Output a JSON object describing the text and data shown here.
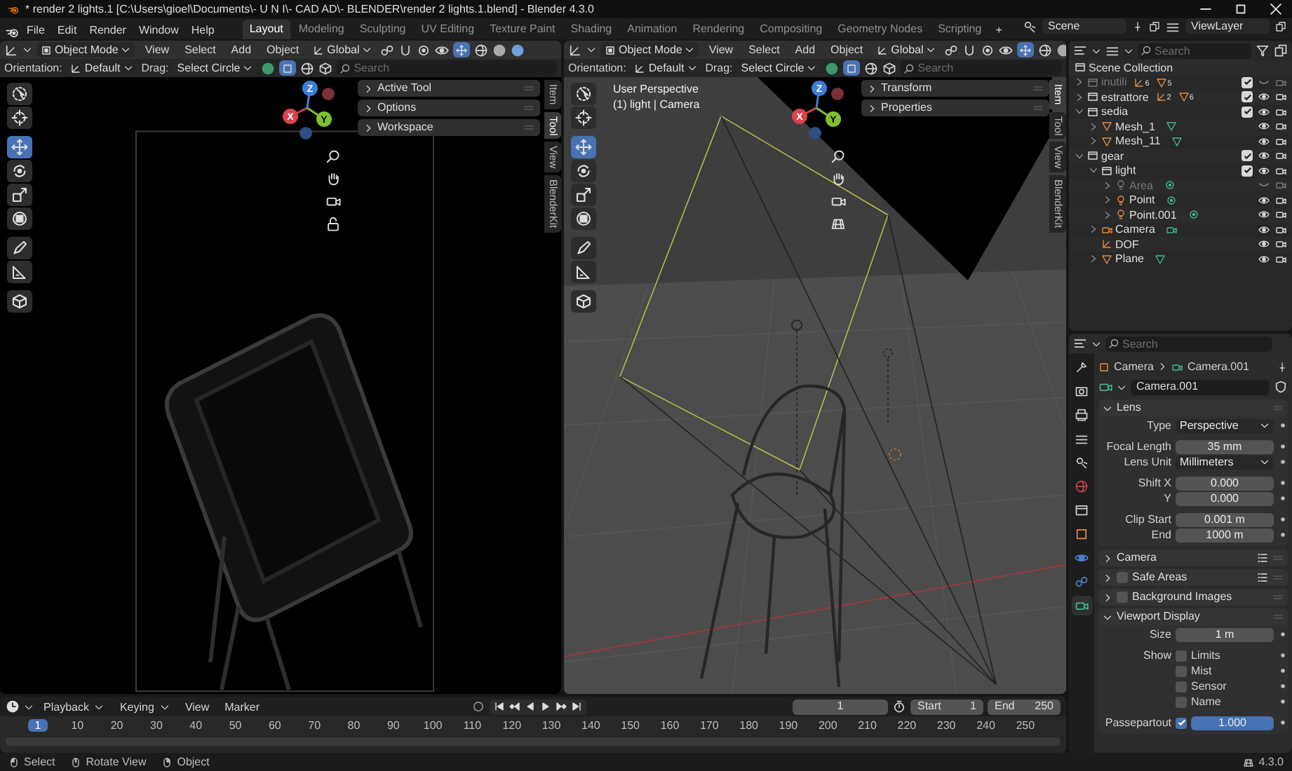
{
  "window": {
    "title": "* render 2 lights.1 [C:\\Users\\gioel\\Documents\\- U N I\\- CAD AD\\- BLENDER\\render 2 lights.1.blend] - Blender 4.3.0"
  },
  "menu": [
    "File",
    "Edit",
    "Render",
    "Window",
    "Help"
  ],
  "workspaces": [
    {
      "label": "Layout",
      "selected": true
    },
    {
      "label": "Modeling",
      "selected": false
    },
    {
      "label": "Sculpting",
      "selected": false
    },
    {
      "label": "UV Editing",
      "selected": false
    },
    {
      "label": "Texture Paint",
      "selected": false
    },
    {
      "label": "Shading",
      "selected": false
    },
    {
      "label": "Animation",
      "selected": false
    },
    {
      "label": "Rendering",
      "selected": false
    },
    {
      "label": "Compositing",
      "selected": false
    },
    {
      "label": "Geometry Nodes",
      "selected": false
    },
    {
      "label": "Scripting",
      "selected": false
    }
  ],
  "add_workspace": "+",
  "scene": "Scene",
  "view_layer": "ViewLayer",
  "viewports": [
    {
      "kind": "camera_render",
      "mode": "Object Mode",
      "menus": [
        "View",
        "Select",
        "Add",
        "Object"
      ],
      "transform": "Global",
      "orientation_label": "Orientation:",
      "orientation": "Default",
      "drag_label": "Drag:",
      "drag": "Select Circle",
      "search_placeholder": "Search",
      "gizmo": [
        "X",
        "Y",
        "Z"
      ],
      "tools": [
        {
          "kind": "select",
          "selected": false
        },
        {
          "kind": "cursor",
          "selected": false
        },
        {
          "kind": "move",
          "selected": true
        },
        {
          "kind": "rotate",
          "selected": false
        },
        {
          "kind": "scale",
          "selected": false
        },
        {
          "kind": "transform",
          "selected": false
        },
        {
          "kind": "annotate",
          "selected": false
        },
        {
          "kind": "measure",
          "selected": false
        },
        {
          "kind": "add_cube",
          "selected": false
        }
      ],
      "panels": [
        {
          "label": "Active Tool",
          "expanded": false
        },
        {
          "label": "Options",
          "expanded": false
        },
        {
          "label": "Workspace",
          "expanded": false
        }
      ],
      "tabs": [
        {
          "label": "Item",
          "selected": false
        },
        {
          "label": "Tool",
          "selected": true
        },
        {
          "label": "View",
          "selected": false
        },
        {
          "label": "BlenderKit",
          "selected": false
        }
      ]
    },
    {
      "kind": "perspective",
      "mode": "Object Mode",
      "menus": [
        "View",
        "Select",
        "Add",
        "Object"
      ],
      "transform": "Global",
      "orientation_label": "Orientation:",
      "orientation": "Default",
      "drag_label": "Drag:",
      "drag": "Select Circle",
      "search_placeholder": "Search",
      "gizmo": [
        "X",
        "Y",
        "Z"
      ],
      "overlay": [
        "User Perspective",
        "(1) light | Camera"
      ],
      "tools": [
        {
          "kind": "select",
          "selected": false
        },
        {
          "kind": "cursor",
          "selected": false
        },
        {
          "kind": "move",
          "selected": true
        },
        {
          "kind": "rotate",
          "selected": false
        },
        {
          "kind": "scale",
          "selected": false
        },
        {
          "kind": "transform",
          "selected": false
        },
        {
          "kind": "annotate",
          "selected": false
        },
        {
          "kind": "measure",
          "selected": false
        },
        {
          "kind": "add_cube",
          "selected": false
        }
      ],
      "panels": [
        {
          "label": "Transform",
          "expanded": false
        },
        {
          "label": "Properties",
          "expanded": false
        }
      ],
      "tabs": [
        {
          "label": "Item",
          "selected": true
        },
        {
          "label": "Tool",
          "selected": false
        },
        {
          "label": "View",
          "selected": false
        },
        {
          "label": "BlenderKit",
          "selected": false
        }
      ]
    }
  ],
  "outliner": {
    "search_placeholder": "Search",
    "root": "Scene Collection",
    "items": [
      {
        "name": "inutili",
        "kind": "collection",
        "expanded": false,
        "checked": true,
        "visible": false,
        "counts": [
          {
            "kind": "empty",
            "count": "6"
          },
          {
            "kind": "mesh",
            "count": "5"
          }
        ]
      },
      {
        "name": "estrattore",
        "kind": "collection",
        "expanded": false,
        "checked": true,
        "visible": true,
        "counts": [
          {
            "kind": "empty",
            "count": "2"
          },
          {
            "kind": "mesh",
            "count": "6"
          }
        ]
      },
      {
        "name": "sedia",
        "kind": "collection",
        "expanded": true,
        "checked": true,
        "visible": true,
        "children": [
          {
            "name": "Mesh_1",
            "kind": "mesh",
            "expanded": false,
            "visible": true
          },
          {
            "name": "Mesh_11",
            "kind": "mesh",
            "expanded": false,
            "visible": true
          }
        ]
      },
      {
        "name": "gear",
        "kind": "collection",
        "expanded": true,
        "checked": true,
        "visible": true,
        "children": [
          {
            "name": "light",
            "kind": "collection",
            "expanded": true,
            "checked": true,
            "visible": true,
            "children": [
              {
                "name": "Area",
                "kind": "light",
                "expanded": false,
                "visible": false
              },
              {
                "name": "Point",
                "kind": "light",
                "expanded": false,
                "visible": true
              },
              {
                "name": "Point.001",
                "kind": "light",
                "expanded": false,
                "visible": true
              }
            ]
          },
          {
            "name": "Camera",
            "kind": "camera",
            "expanded": false,
            "visible": true
          },
          {
            "name": "DOF",
            "kind": "empty",
            "visible": true
          },
          {
            "name": "Plane",
            "kind": "mesh",
            "expanded": false,
            "visible": true
          }
        ]
      }
    ]
  },
  "properties": {
    "search_placeholder": "Search",
    "tabs": [
      {
        "kind": "tool",
        "selected": false
      },
      {
        "kind": "render",
        "selected": false
      },
      {
        "kind": "output",
        "selected": false
      },
      {
        "kind": "view_layer",
        "selected": false
      },
      {
        "kind": "scene",
        "selected": false
      },
      {
        "kind": "world",
        "selected": false
      },
      {
        "kind": "collection",
        "selected": false
      },
      {
        "kind": "object",
        "selected": false
      },
      {
        "kind": "physics",
        "selected": false
      },
      {
        "kind": "constraints",
        "selected": false
      },
      {
        "kind": "data",
        "selected": true
      }
    ],
    "breadcrumb": [
      "Camera",
      "Camera.001"
    ],
    "datablock": "Camera.001",
    "sections": [
      {
        "title": "Lens",
        "expanded": true,
        "groups": [
          [
            {
              "kind": "dropdown",
              "label": "Type",
              "value": "Perspective"
            }
          ],
          [
            {
              "kind": "number",
              "label": "Focal Length",
              "value": "35 mm"
            },
            {
              "kind": "dropdown",
              "label": "Lens Unit",
              "value": "Millimeters"
            }
          ],
          [
            {
              "kind": "number",
              "label": "Shift X",
              "value": "0.000"
            },
            {
              "kind": "number",
              "label": "Y",
              "value": "0.000"
            }
          ],
          [
            {
              "kind": "number",
              "label": "Clip Start",
              "value": "0.001 m"
            },
            {
              "kind": "number",
              "label": "End",
              "value": "1000 m"
            }
          ]
        ]
      },
      {
        "title": "Camera",
        "expanded": false,
        "presets": true
      },
      {
        "title": "Safe Areas",
        "expanded": false,
        "checked": false,
        "presets": true
      },
      {
        "title": "Background Images",
        "expanded": false,
        "checked": false
      },
      {
        "title": "Viewport Display",
        "expanded": true,
        "groups": [
          [
            {
              "kind": "number",
              "label": "Size",
              "value": "1 m"
            }
          ],
          [
            {
              "kind": "check",
              "label": "Show",
              "text": "Limits",
              "checked": false
            },
            {
              "kind": "check",
              "text": "Mist",
              "checked": false
            },
            {
              "kind": "check",
              "text": "Sensor",
              "checked": false
            },
            {
              "kind": "check",
              "text": "Name",
              "checked": false
            }
          ],
          [
            {
              "kind": "slider_check",
              "label": "Passepartout",
              "checked": true,
              "value": "1.000",
              "level": 1
            }
          ]
        ]
      }
    ]
  },
  "timeline": {
    "menus": [
      {
        "label": "Playback",
        "dropdown": true
      },
      {
        "label": "Keying",
        "dropdown": true
      },
      {
        "label": "View",
        "dropdown": false
      },
      {
        "label": "Marker",
        "dropdown": false
      }
    ],
    "current_frame": "1",
    "start_label": "Start",
    "start": "1",
    "end_label": "End",
    "end": "250",
    "ruler": [
      {
        "label": "1",
        "current": true
      },
      {
        "label": "10",
        "current": false
      },
      {
        "label": "20",
        "current": false
      },
      {
        "label": "30",
        "current": false
      },
      {
        "label": "40",
        "current": false
      },
      {
        "label": "50",
        "current": false
      },
      {
        "label": "60",
        "current": false
      },
      {
        "label": "70",
        "current": false
      },
      {
        "label": "80",
        "current": false
      },
      {
        "label": "90",
        "current": false
      },
      {
        "label": "100",
        "current": false
      },
      {
        "label": "110",
        "current": false
      },
      {
        "label": "120",
        "current": false
      },
      {
        "label": "130",
        "current": false
      },
      {
        "label": "140",
        "current": false
      },
      {
        "label": "150",
        "current": false
      },
      {
        "label": "160",
        "current": false
      },
      {
        "label": "170",
        "current": false
      },
      {
        "label": "180",
        "current": false
      },
      {
        "label": "190",
        "current": false
      },
      {
        "label": "200",
        "current": false
      },
      {
        "label": "210",
        "current": false
      },
      {
        "label": "220",
        "current": false
      },
      {
        "label": "230",
        "current": false
      },
      {
        "label": "240",
        "current": false
      },
      {
        "label": "250",
        "current": false
      }
    ]
  },
  "status_bar": {
    "items": [
      {
        "kind": "left_click",
        "label": "Select"
      },
      {
        "kind": "middle_click",
        "label": "Rotate View"
      },
      {
        "kind": "right_click",
        "label": "Object"
      }
    ],
    "version": "4.3.0"
  }
}
